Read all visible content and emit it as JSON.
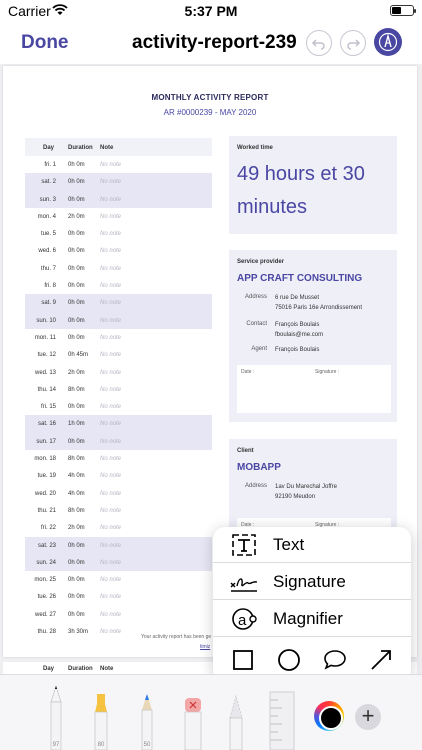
{
  "status_bar": {
    "carrier": "Carrier",
    "time": "5:37 PM"
  },
  "nav": {
    "done_label": "Done",
    "title": "activity-report-239"
  },
  "report": {
    "title": "MONTHLY ACTIVITY REPORT",
    "subtitle": "AR #0000239 - MAY 2020",
    "columns": [
      "Day",
      "Duration",
      "Note"
    ],
    "rows": [
      {
        "day": "fri. 1",
        "duration": "0h 0m",
        "note": "No note",
        "weekend": false
      },
      {
        "day": "sat. 2",
        "duration": "0h 0m",
        "note": "No note",
        "weekend": true
      },
      {
        "day": "sun. 3",
        "duration": "0h 0m",
        "note": "No note",
        "weekend": true
      },
      {
        "day": "mon. 4",
        "duration": "2h 0m",
        "note": "No note",
        "weekend": false
      },
      {
        "day": "tue. 5",
        "duration": "0h 0m",
        "note": "No note",
        "weekend": false
      },
      {
        "day": "wed. 6",
        "duration": "0h 0m",
        "note": "No note",
        "weekend": false
      },
      {
        "day": "thu. 7",
        "duration": "0h 0m",
        "note": "No note",
        "weekend": false
      },
      {
        "day": "fri. 8",
        "duration": "0h 0m",
        "note": "No note",
        "weekend": false
      },
      {
        "day": "sat. 9",
        "duration": "0h 0m",
        "note": "No note",
        "weekend": true
      },
      {
        "day": "sun. 10",
        "duration": "0h 0m",
        "note": "No note",
        "weekend": true
      },
      {
        "day": "mon. 11",
        "duration": "0h 0m",
        "note": "No note",
        "weekend": false
      },
      {
        "day": "tue. 12",
        "duration": "0h 45m",
        "note": "No note",
        "weekend": false
      },
      {
        "day": "wed. 13",
        "duration": "2h 0m",
        "note": "No note",
        "weekend": false
      },
      {
        "day": "thu. 14",
        "duration": "8h 0m",
        "note": "No note",
        "weekend": false
      },
      {
        "day": "fri. 15",
        "duration": "0h 0m",
        "note": "No note",
        "weekend": false
      },
      {
        "day": "sat. 16",
        "duration": "1h 0m",
        "note": "No note",
        "weekend": true
      },
      {
        "day": "sun. 17",
        "duration": "0h 0m",
        "note": "No note",
        "weekend": true
      },
      {
        "day": "mon. 18",
        "duration": "8h 0m",
        "note": "No note",
        "weekend": false
      },
      {
        "day": "tue. 19",
        "duration": "4h 0m",
        "note": "No note",
        "weekend": false
      },
      {
        "day": "wed. 20",
        "duration": "4h 0m",
        "note": "No note",
        "weekend": false
      },
      {
        "day": "thu. 21",
        "duration": "8h 0m",
        "note": "No note",
        "weekend": false
      },
      {
        "day": "fri. 22",
        "duration": "2h 0m",
        "note": "No note",
        "weekend": false
      },
      {
        "day": "sat. 23",
        "duration": "0h 0m",
        "note": "No note",
        "weekend": true
      },
      {
        "day": "sun. 24",
        "duration": "0h 0m",
        "note": "No note",
        "weekend": true
      },
      {
        "day": "mon. 25",
        "duration": "0h 0m",
        "note": "No note",
        "weekend": false
      },
      {
        "day": "tue. 26",
        "duration": "0h 0m",
        "note": "No note",
        "weekend": false
      },
      {
        "day": "wed. 27",
        "duration": "0h 0m",
        "note": "No note",
        "weekend": false
      },
      {
        "day": "thu. 28",
        "duration": "3h 30m",
        "note": "No note",
        "weekend": false
      }
    ],
    "worked_time": {
      "label": "Worked time",
      "value": "49 hours et 30 minutes"
    },
    "provider": {
      "label": "Service provider",
      "name": "APP CRAFT CONSULTING",
      "address_label": "Address",
      "address_line1": "6 rue De Musset",
      "address_line2": "75016 Paris 16e Arrondissement",
      "contact_label": "Contact",
      "contact_name": "François Boulais",
      "contact_email": "fboulais@me.com",
      "agent_label": "Agent",
      "agent_name": "François Boulais",
      "date_label": "Date :",
      "signature_label": "Signature :"
    },
    "client": {
      "label": "Client",
      "name": "MOBAPP",
      "address_label": "Address",
      "address_line1": "1av Du Marechal Joffre",
      "address_line2": "92190 Meudon",
      "date_label": "Date :",
      "signature_label": "Signature :"
    },
    "footer_note": "Your activity report has been ge",
    "footer_link": "timiz"
  },
  "popover": {
    "items": [
      {
        "label": "Text",
        "icon": "text-box-icon"
      },
      {
        "label": "Signature",
        "icon": "signature-icon"
      },
      {
        "label": "Magnifier",
        "icon": "magnifier-icon"
      }
    ],
    "shapes": [
      "square-icon",
      "circle-icon",
      "speech-bubble-icon",
      "arrow-icon"
    ]
  },
  "toolbar": {
    "tools": [
      {
        "name": "pen",
        "width": "97"
      },
      {
        "name": "highlighter",
        "width": "80"
      },
      {
        "name": "pencil",
        "width": "50"
      },
      {
        "name": "eraser"
      },
      {
        "name": "lasso"
      },
      {
        "name": "ruler"
      }
    ],
    "accent": "#4a47a3"
  }
}
